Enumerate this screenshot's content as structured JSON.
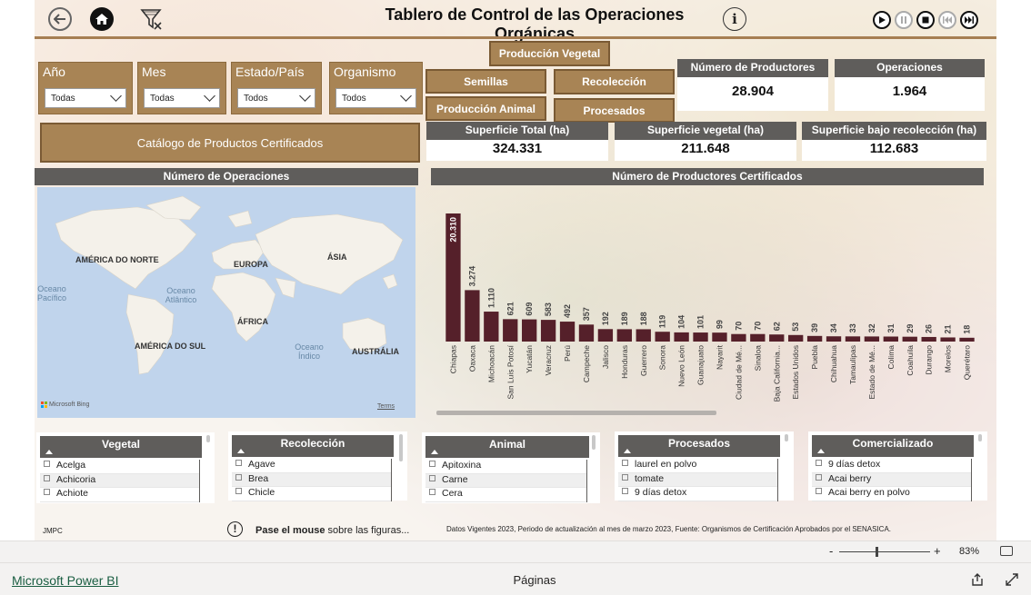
{
  "header": {
    "title": "Tablero de Control de las Operaciones Orgánicas",
    "back_icon": "back-arrow-icon",
    "home_icon": "home-icon",
    "filter_icon": "clear-filter-icon",
    "info_icon": "info-icon"
  },
  "slicers": [
    {
      "label": "Año",
      "value": "Todas"
    },
    {
      "label": "Mes",
      "value": "Todas"
    },
    {
      "label": "Estado/País",
      "value": "Todos"
    },
    {
      "label": "Organismo",
      "value": "Todos"
    }
  ],
  "buttons": {
    "produccion_vegetal": "Producción Vegetal",
    "semillas": "Semillas",
    "recoleccion": "Recolección",
    "produccion_animal": "Producción Animal",
    "procesados": "Procesados",
    "catalogo": "Catálogo de Productos Certificados"
  },
  "kpis": {
    "productores": {
      "label": "Número de Productores",
      "value": "28.904"
    },
    "operaciones": {
      "label": "Operaciones",
      "value": "1.964"
    },
    "sup_total": {
      "label": "Superficie  Total (ha)",
      "value": "324.331"
    },
    "sup_vegetal": {
      "label": "Superficie  vegetal (ha)",
      "value": "211.648"
    },
    "sup_recoleccion": {
      "label": "Superficie bajo recolección (ha)",
      "value": "112.683"
    }
  },
  "map": {
    "title": "Número de Operaciones",
    "labels": [
      "AMÉRICA DO NORTE",
      "EUROPA",
      "ÁSIA",
      "ÁFRICA",
      "AMÉRICA DO SUL",
      "AUSTRÁLIA"
    ],
    "oceans": [
      "Oceano Pacífico",
      "Oceano Atlântico",
      "Oceano Índico"
    ],
    "attribution": "Microsoft Bing",
    "terms": "Terms"
  },
  "chart_data": {
    "type": "bar",
    "title": "Número de Productores Certificados",
    "categories": [
      "Chiapas",
      "Oaxaca",
      "Michoacán",
      "San Luis Potosí",
      "Yucatán",
      "Veracruz",
      "Perú",
      "Campeche",
      "Jalisco",
      "Honduras",
      "Guerrero",
      "Sonora",
      "Nuevo León",
      "Guanajuato",
      "Nayarit",
      "Ciudad de Mé...",
      "Sinaloa",
      "Baja California...",
      "Estados Unidos",
      "Puebla",
      "Chihuahua",
      "Tamaulipas",
      "Estado de Mé...",
      "Colima",
      "Coahuila",
      "Durango",
      "Morelos",
      "Querétaro"
    ],
    "values": [
      20310,
      3274,
      1110,
      621,
      609,
      583,
      492,
      357,
      192,
      189,
      188,
      119,
      104,
      101,
      99,
      70,
      70,
      62,
      53,
      39,
      34,
      33,
      32,
      31,
      29,
      26,
      21,
      18
    ],
    "bar_color": "#55202a"
  },
  "panels": [
    {
      "title": "Vegetal",
      "items": [
        "Acelga",
        "Achicoria",
        "Achiote"
      ]
    },
    {
      "title": "Recolección",
      "items": [
        "Agave",
        "Brea",
        "Chicle"
      ]
    },
    {
      "title": "Animal",
      "items": [
        "Apitoxina",
        "Carne",
        "Cera"
      ]
    },
    {
      "title": "Procesados",
      "items": [
        "laurel en polvo",
        "tomate",
        "9 días detox"
      ]
    },
    {
      "title": "Comercializado",
      "items": [
        "9 días detox",
        "Acai berry",
        "Acai berry en polvo"
      ]
    }
  ],
  "footer": {
    "author": "JMPC",
    "hint_bold": "Pase el mouse",
    "hint_rest": " sobre las figuras...",
    "source": "Datos Vigentes 2023, Periodo de actualización  al mes de marzo 2023, Fuente: Organismos  de Certificación Aprobados por el SENASICA."
  },
  "zoom": {
    "minus": "-",
    "plus": "+",
    "level": "83%",
    "value": 0.83
  },
  "bottom": {
    "brand": "Microsoft Power BI",
    "pages": "Páginas"
  }
}
